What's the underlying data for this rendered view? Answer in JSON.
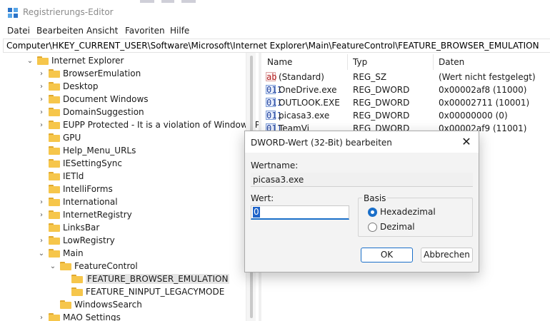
{
  "window": {
    "title": "Registrierungs-Editor",
    "icon": "registry-editor-icon"
  },
  "menu": {
    "items": [
      "Datei",
      "Bearbeiten",
      "Ansicht",
      "Favoriten",
      "Hilfe"
    ]
  },
  "address": {
    "path": "Computer\\HKEY_CURRENT_USER\\Software\\Microsoft\\Internet Explorer\\Main\\FeatureControl\\FEATURE_BROWSER_EMULATION"
  },
  "tree": {
    "root": "Internet Explorer",
    "children": [
      "BrowserEmulation",
      "Desktop",
      "Document Windows",
      "DomainSuggestion",
      "EUPP Protected - It is a violation of Windows Pol",
      "GPU",
      "Help_Menu_URLs",
      "IESettingSync",
      "IETld",
      "IntelliForms",
      "International",
      "InternetRegistry",
      "LinksBar",
      "LowRegistry",
      "Main"
    ],
    "main_child": "FeatureControl",
    "feature_children": [
      "FEATURE_BROWSER_EMULATION",
      "FEATURE_NINPUT_LEGACYMODE"
    ],
    "after_feature": "WindowsSearch",
    "last": "MAO Settings",
    "selected": "FEATURE_BROWSER_EMULATION"
  },
  "list": {
    "columns": [
      "Name",
      "Typ",
      "Daten"
    ],
    "rows": [
      {
        "icon": "ab",
        "name": "(Standard)",
        "type": "REG_SZ",
        "data": "(Wert nicht festgelegt)"
      },
      {
        "icon": "dword",
        "name": "OneDrive.exe",
        "type": "REG_DWORD",
        "data": "0x00002af8 (11000)"
      },
      {
        "icon": "dword",
        "name": "OUTLOOK.EXE",
        "type": "REG_DWORD",
        "data": "0x00002711 (10001)"
      },
      {
        "icon": "dword",
        "name": "picasa3.exe",
        "type": "REG_DWORD",
        "data": "0x00000000 (0)"
      },
      {
        "icon": "dword",
        "name": "TeamVi",
        "type": "REG_DWORD",
        "data": "0x00002af9 (11001)"
      }
    ],
    "icon_labels": {
      "ab": "ab",
      "dword": "011"
    }
  },
  "dialog": {
    "title": "DWORD-Wert (32-Bit) bearbeiten",
    "close": "✕",
    "name_label": "Wertname:",
    "name_value": "picasa3.exe",
    "value_label": "Wert:",
    "value": "0",
    "base_label": "Basis",
    "hex_label": "Hexadezimal",
    "dec_label": "Dezimal",
    "selected_base": "Hexadezimal",
    "ok": "OK",
    "cancel": "Abbrechen"
  },
  "colors": {
    "accent": "#1a6fc9",
    "folder": "#f6c64b",
    "selection": "#e5e5e5"
  }
}
